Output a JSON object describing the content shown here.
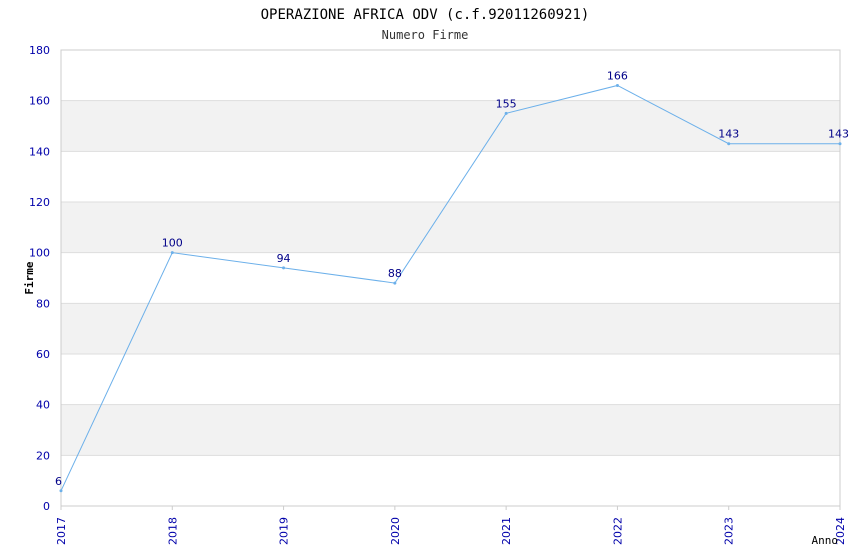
{
  "chart_data": {
    "type": "line",
    "title": "OPERAZIONE AFRICA ODV (c.f.92011260921)",
    "subtitle": "Numero Firme",
    "xlabel": "Anno",
    "ylabel": "Firme",
    "x": [
      "2017",
      "2018",
      "2019",
      "2020",
      "2021",
      "2022",
      "2023",
      "2024"
    ],
    "values": [
      6,
      100,
      94,
      88,
      155,
      166,
      143,
      143
    ],
    "yticks": [
      0,
      20,
      40,
      60,
      80,
      100,
      120,
      140,
      160,
      180
    ],
    "ylim": [
      0,
      180
    ],
    "grid": true,
    "colors": {
      "line": "#6cb0ea",
      "tick_label": "#0000aa",
      "data_label": "#000088",
      "band": "#f2f2f2",
      "gridline": "#dddddd",
      "axis": "#cccccc"
    }
  }
}
